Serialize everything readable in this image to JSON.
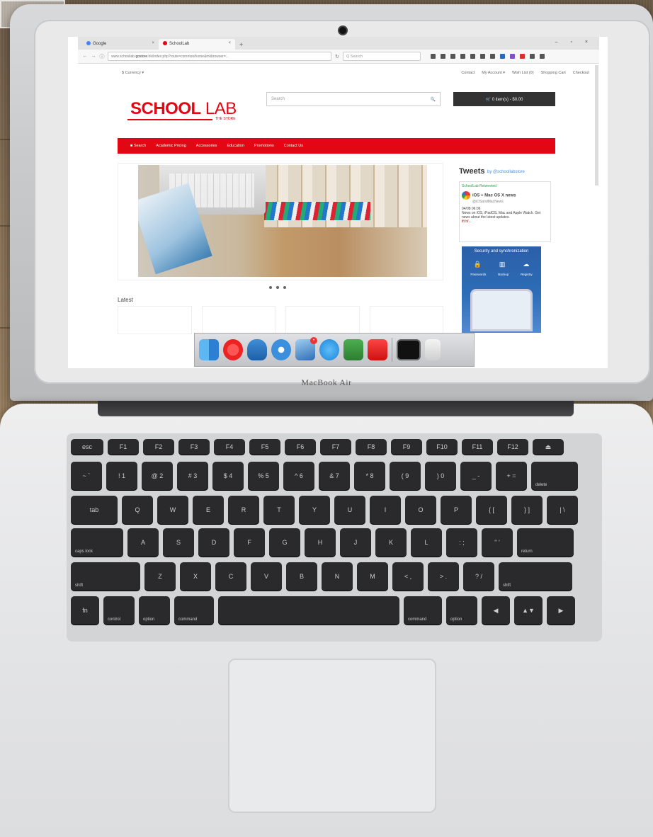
{
  "browser": {
    "tabs": [
      {
        "label": "Google",
        "active": false
      },
      {
        "label": "SchoolLab",
        "active": true
      }
    ],
    "url_prefix": "www.schoollab.",
    "url_domain": "gostore",
    "url_suffix": ".hk/index.php?route=common/home&mkbrowser=...",
    "search_placeholder": "Q Search"
  },
  "site": {
    "currency": "$ Currency ▾",
    "top_links": [
      "Contact",
      "My Account ▾",
      "Wish List (0)",
      "Shopping Cart",
      "Checkout"
    ],
    "logo_bold": "SCHOOL",
    "logo_light": " LAB",
    "logo_sub": "THE STORE",
    "search_placeholder": "Search",
    "search_icon": "🔍",
    "cart_label": "🛒 0 item(s) - $0.00",
    "nav": [
      "■ Search",
      "Academic Pricing",
      "Accessories",
      "Education",
      "Promotions",
      "Contact Us"
    ],
    "latest_label": "Latest",
    "tweets_title": "Tweets",
    "tweets_by": "by @schoollabstore",
    "tweet": {
      "retweet": "SchoolLab Retweeted",
      "handle": "iOS + Mac OS X news",
      "account": "@iOSandMacNews",
      "date": "04/08 06:06",
      "body": "News on iOS, iPadOS, Mac and Apple Watch. Get news about the latest updates.",
      "link": "ift.tt/..."
    },
    "ad": {
      "title": "Security and synchronization",
      "labels": [
        "Passwords",
        "Backup",
        "Registry"
      ]
    }
  },
  "laptop": {
    "brand": "MacBook Air"
  },
  "keyboard": {
    "fn_row": [
      "esc",
      "F1",
      "F2",
      "F3",
      "F4",
      "F5",
      "F6",
      "F7",
      "F8",
      "F9",
      "F10",
      "F11",
      "F12",
      "⏏"
    ],
    "row1": [
      "~\n`",
      "!\n1",
      "@\n2",
      "#\n3",
      "$\n4",
      "%\n5",
      "^\n6",
      "&\n7",
      "*\n8",
      "(\n9",
      ")\n0",
      "_\n-",
      "+\n=",
      "delete"
    ],
    "row2": [
      "tab",
      "Q",
      "W",
      "E",
      "R",
      "T",
      "Y",
      "U",
      "I",
      "O",
      "P",
      "{\n[",
      "}\n]",
      "|\n\\"
    ],
    "row3": [
      "caps lock",
      "A",
      "S",
      "D",
      "F",
      "G",
      "H",
      "J",
      "K",
      "L",
      ":\n;",
      "\"\n'",
      "return"
    ],
    "row4": [
      "shift",
      "Z",
      "X",
      "C",
      "V",
      "B",
      "N",
      "M",
      "<\n,",
      ">\n.",
      "?\n/",
      "shift"
    ],
    "row5": [
      "fn",
      "control",
      "option",
      "command",
      "",
      "command",
      "option",
      "◀",
      "▲▼",
      "▶"
    ]
  },
  "colors": {
    "brand_red": "#e30613",
    "dark_button": "#333333"
  }
}
